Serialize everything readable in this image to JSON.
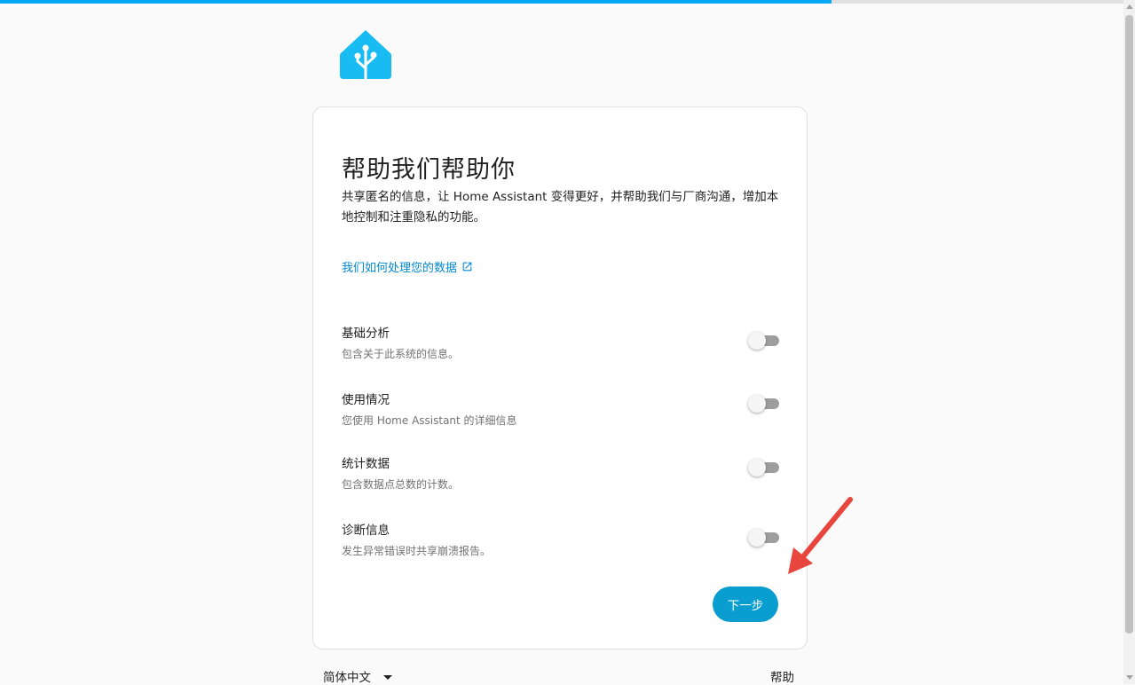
{
  "header": {
    "progress_percent": 74
  },
  "logo": {
    "name": "home-assistant-logo",
    "color": "#18bcf2"
  },
  "card": {
    "title": "帮助我们帮助你",
    "description": "共享匿名的信息，让 Home Assistant 变得更好，并帮助我们与厂商沟通，增加本地控制和注重隐私的功能。",
    "link_label": "我们如何处理您的数据",
    "link_icon": "open-in-new-icon",
    "options": [
      {
        "title": "基础分析",
        "description": "包含关于此系统的信息。",
        "enabled": false
      },
      {
        "title": "使用情况",
        "description": "您使用 Home Assistant 的详细信息",
        "enabled": false
      },
      {
        "title": "统计数据",
        "description": "包含数据点总数的计数。",
        "enabled": false
      },
      {
        "title": "诊断信息",
        "description": "发生异常错误时共享崩溃报告。",
        "enabled": false
      }
    ],
    "next_button_label": "下一步"
  },
  "footer": {
    "language": "简体中文",
    "help_label": "帮助"
  },
  "colors": {
    "accent": "#03a9f4",
    "button": "#0a9dd0",
    "link": "#0288d1",
    "annotation_arrow": "#e8453c"
  }
}
